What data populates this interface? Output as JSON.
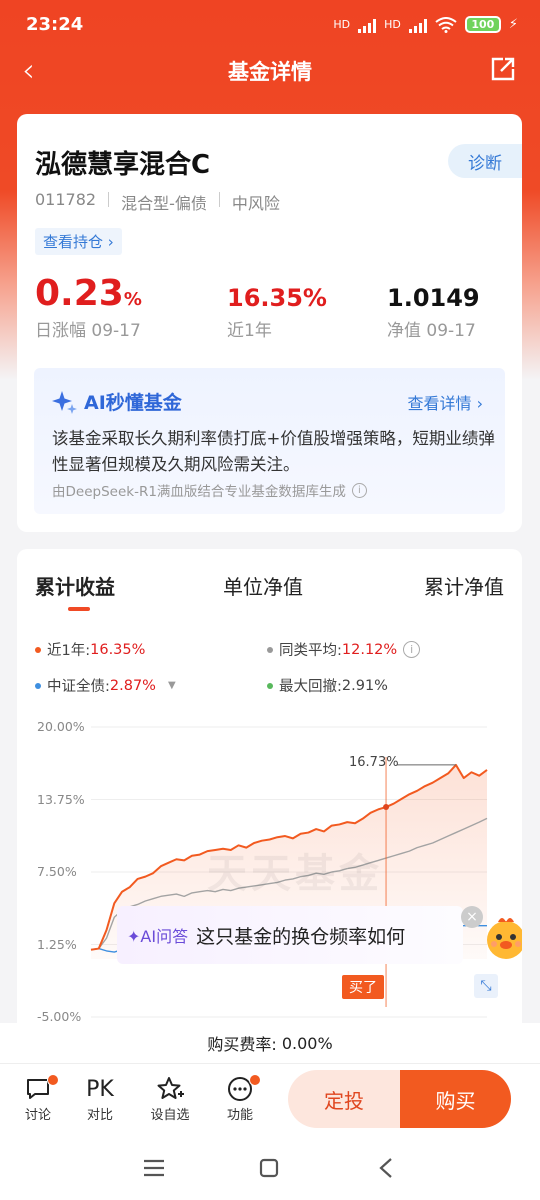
{
  "status": {
    "time": "23:24",
    "net1": "HD",
    "net2": "HD",
    "battery": "100"
  },
  "nav": {
    "title": "基金详情"
  },
  "fund": {
    "name": "泓德慧享混合C",
    "diagnose": "诊断",
    "code": "011782",
    "type": "混合型-偏债",
    "risk": "中风险",
    "holdings_link": "查看持仓 ›",
    "daily_change": "0.23",
    "daily_change_unit": "%",
    "daily_change_label": "日涨幅 09-17",
    "year_return": "16.35%",
    "year_return_label": "近1年",
    "nav_value": "1.0149",
    "nav_label": "净值 09-17"
  },
  "ai": {
    "title": "AI秒懂基金",
    "more": "查看详情 ›",
    "text": "该基金采取长久期利率债打底+价值股增强策略，短期业绩弹性显著但规模及久期风险需关注。",
    "source": "由DeepSeek-R1满血版结合专业基金数据库生成"
  },
  "perf": {
    "tabs": [
      "累计收益",
      "单位净值",
      "累计净值"
    ],
    "legend": {
      "fund_label": "近1年:",
      "fund_value": "16.35%",
      "peer_label": "同类平均:",
      "peer_value": "12.12%",
      "index_label": "中证全债:",
      "index_value": "2.87%",
      "dd_label": "最大回撤:",
      "dd_value": "2.91%"
    },
    "peak_label": "16.73%",
    "watermark": "天天基金",
    "ai_qa_tag": "AI问答",
    "ai_qa_text": "这只基金的换仓频率如何",
    "buy_marker": "买了"
  },
  "chart_data": {
    "type": "line",
    "yticks": [
      "20.00%",
      "13.75%",
      "7.50%",
      "1.25%",
      "-5.00%"
    ],
    "ylim": [
      -5.0,
      20.0
    ],
    "series": [
      {
        "name": "近1年",
        "color": "#f25a20",
        "values": [
          0.8,
          0.9,
          2.5,
          4.8,
          5.8,
          6.2,
          6.9,
          7.1,
          7.4,
          8.0,
          8.3,
          8.6,
          8.5,
          8.9,
          9.0,
          9.3,
          9.4,
          9.5,
          9.4,
          9.8,
          9.6,
          10.0,
          10.2,
          10.3,
          10.5,
          10.6,
          10.4,
          10.8,
          10.9,
          11.2,
          11.0,
          11.5,
          11.6,
          11.8,
          11.7,
          12.1,
          12.6,
          12.9,
          13.1,
          13.4,
          13.8,
          14.2,
          14.5,
          14.9,
          15.2,
          15.6,
          16.0,
          16.73,
          15.6,
          16.1,
          15.8,
          16.3
        ]
      },
      {
        "name": "同类平均",
        "color": "#a3a3a3",
        "values": [
          0.8,
          0.9,
          1.8,
          3.6,
          4.2,
          4.5,
          4.7,
          5.0,
          5.2,
          5.4,
          5.5,
          5.6,
          5.4,
          5.7,
          5.8,
          5.9,
          5.8,
          6.0,
          5.9,
          6.1,
          6.2,
          6.3,
          6.4,
          6.5,
          6.6,
          6.8,
          6.9,
          7.1,
          7.2,
          7.4,
          7.3,
          7.5,
          7.6,
          7.8,
          7.9,
          8.1,
          8.3,
          8.5,
          8.7,
          8.9,
          9.1,
          9.3,
          9.6,
          9.8,
          10.0,
          10.3,
          10.6,
          10.9,
          11.2,
          11.5,
          11.8,
          12.12
        ]
      },
      {
        "name": "中证全债",
        "color": "#3e8fe0",
        "values": [
          0.8,
          0.9,
          0.7,
          0.6,
          0.8,
          1.0,
          1.2,
          1.3,
          1.5,
          1.6,
          1.7,
          1.8,
          1.9,
          2.0,
          2.0,
          2.1,
          2.2,
          2.2,
          2.3,
          2.3,
          2.4,
          2.4,
          2.5,
          2.5,
          2.5,
          2.6,
          2.6,
          2.6,
          2.7,
          2.7,
          2.7,
          2.7,
          2.8,
          2.8,
          2.8,
          2.8,
          2.8,
          2.8,
          2.9,
          2.9,
          2.9,
          2.9,
          2.9,
          2.9,
          2.9,
          2.9,
          2.87,
          2.87,
          2.87,
          2.87,
          2.87,
          2.87
        ]
      }
    ]
  },
  "fee": {
    "label": "购买费率:",
    "value": "0.00%"
  },
  "actions": {
    "discuss": "讨论",
    "pk_icon": "PK",
    "pk": "对比",
    "watch": "设自选",
    "more": "功能",
    "sip": "定投",
    "buy": "购买"
  }
}
